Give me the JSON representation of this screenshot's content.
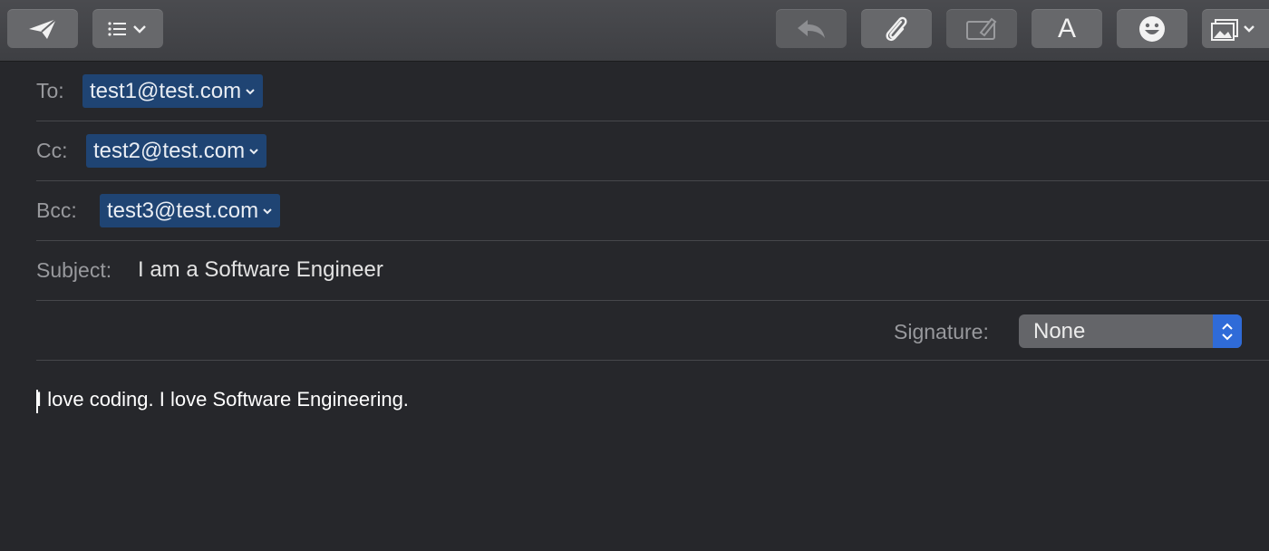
{
  "toolbar": {
    "buttons": [
      {
        "name": "send-button",
        "icon": "paper-plane-icon"
      },
      {
        "name": "header-fields-menu-button",
        "icon": "list-icon"
      },
      {
        "name": "reply-button",
        "icon": "reply-arrow-icon"
      },
      {
        "name": "attach-button",
        "icon": "paperclip-icon"
      },
      {
        "name": "markup-button",
        "icon": "markup-pencil-icon"
      },
      {
        "name": "format-button",
        "icon": "font-a-icon",
        "label": "A"
      },
      {
        "name": "emoji-button",
        "icon": "smiley-icon"
      },
      {
        "name": "photo-browser-button",
        "icon": "photo-icon"
      }
    ]
  },
  "fields": {
    "to": {
      "label": "To:",
      "recipient": "test1@test.com"
    },
    "cc": {
      "label": "Cc:",
      "recipient": "test2@test.com"
    },
    "bcc": {
      "label": "Bcc:",
      "recipient": "test3@test.com"
    },
    "subject": {
      "label": "Subject:",
      "value": "I am a Software Engineer"
    }
  },
  "signature": {
    "label": "Signature:",
    "value": "None"
  },
  "body": {
    "text": "I love coding. I love Software Engineering."
  },
  "colors": {
    "background": "#26272b",
    "toolbar": "#434448",
    "chip": "#1f4473",
    "stepper_accent": "#2f6bd8"
  }
}
